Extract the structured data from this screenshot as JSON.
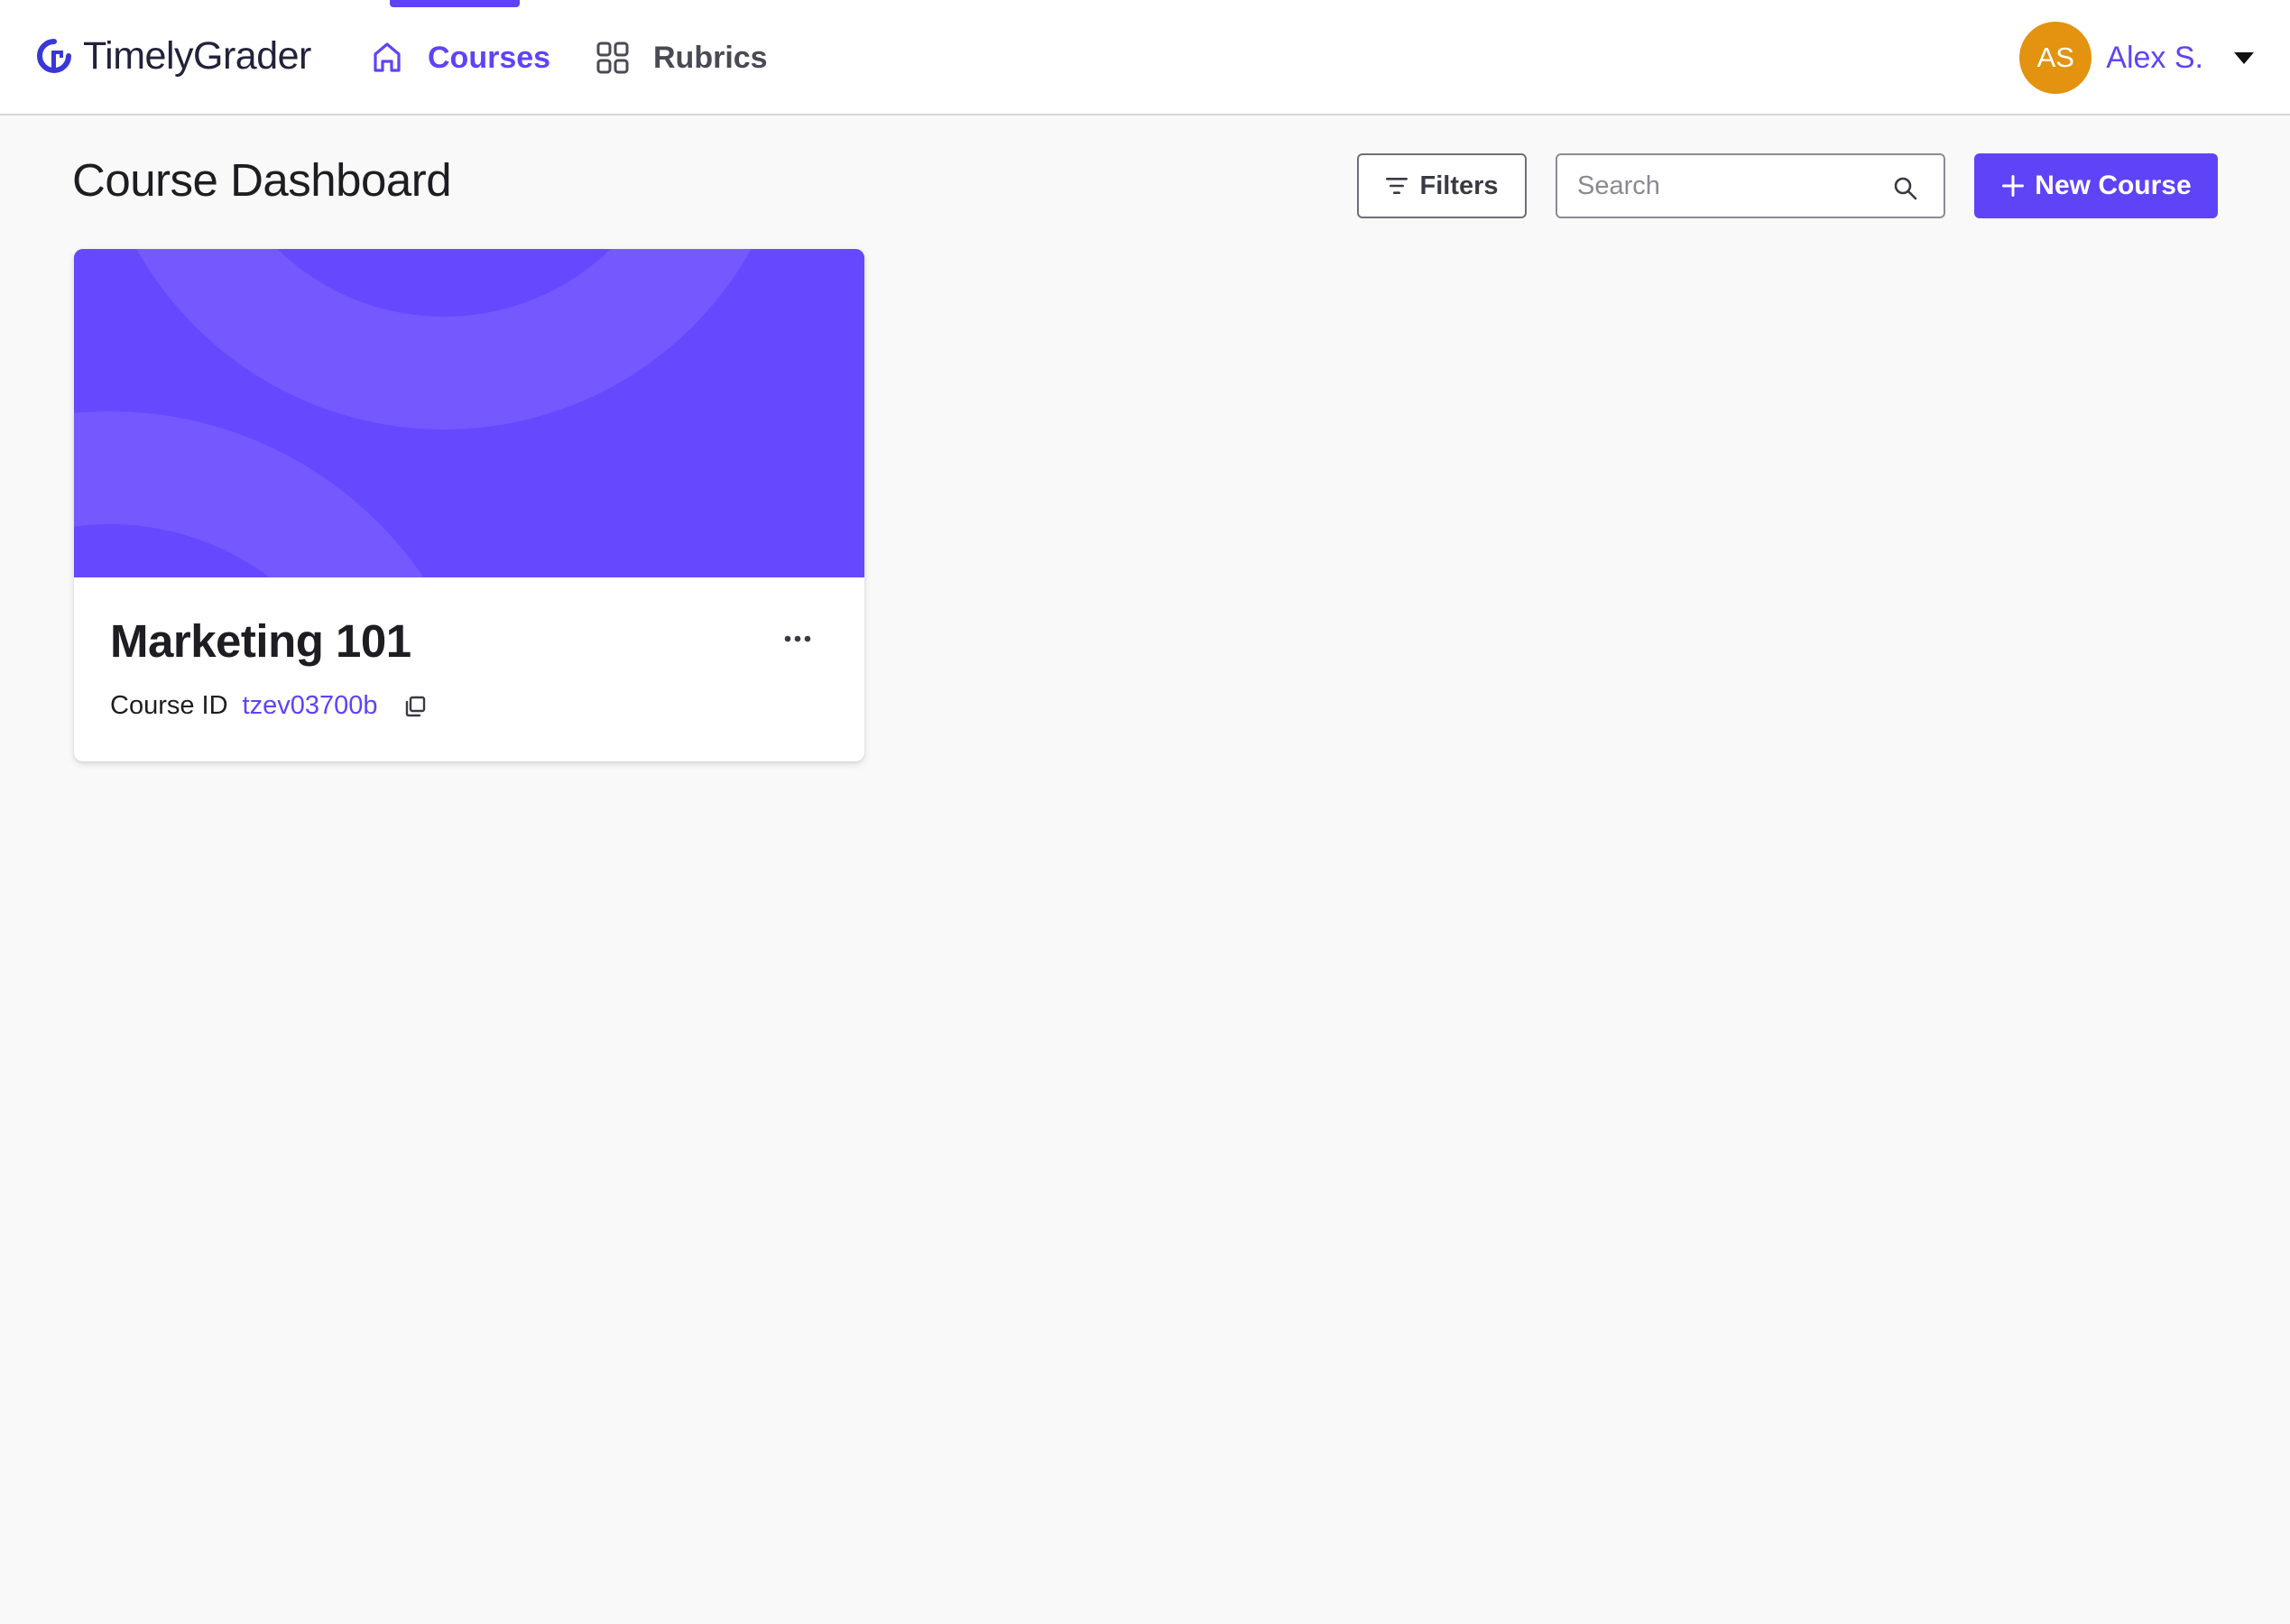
{
  "app": {
    "brand_name": "TimelyGrader",
    "accent_color": "#5f43f7",
    "avatar_color": "#e3930f"
  },
  "nav": {
    "items": [
      {
        "label": "Courses",
        "icon": "home-icon",
        "active": true
      },
      {
        "label": "Rubrics",
        "icon": "grid-icon",
        "active": false
      }
    ]
  },
  "user": {
    "initials": "AS",
    "name": "Alex S."
  },
  "page": {
    "title": "Course Dashboard"
  },
  "toolbar": {
    "filters_label": "Filters",
    "search_placeholder": "Search",
    "search_value": "",
    "new_course_label": "New Course"
  },
  "courses": [
    {
      "name": "Marketing 101",
      "id_label": "Course ID",
      "id_value": "tzev03700b",
      "banner_color": "#6649ff"
    }
  ]
}
